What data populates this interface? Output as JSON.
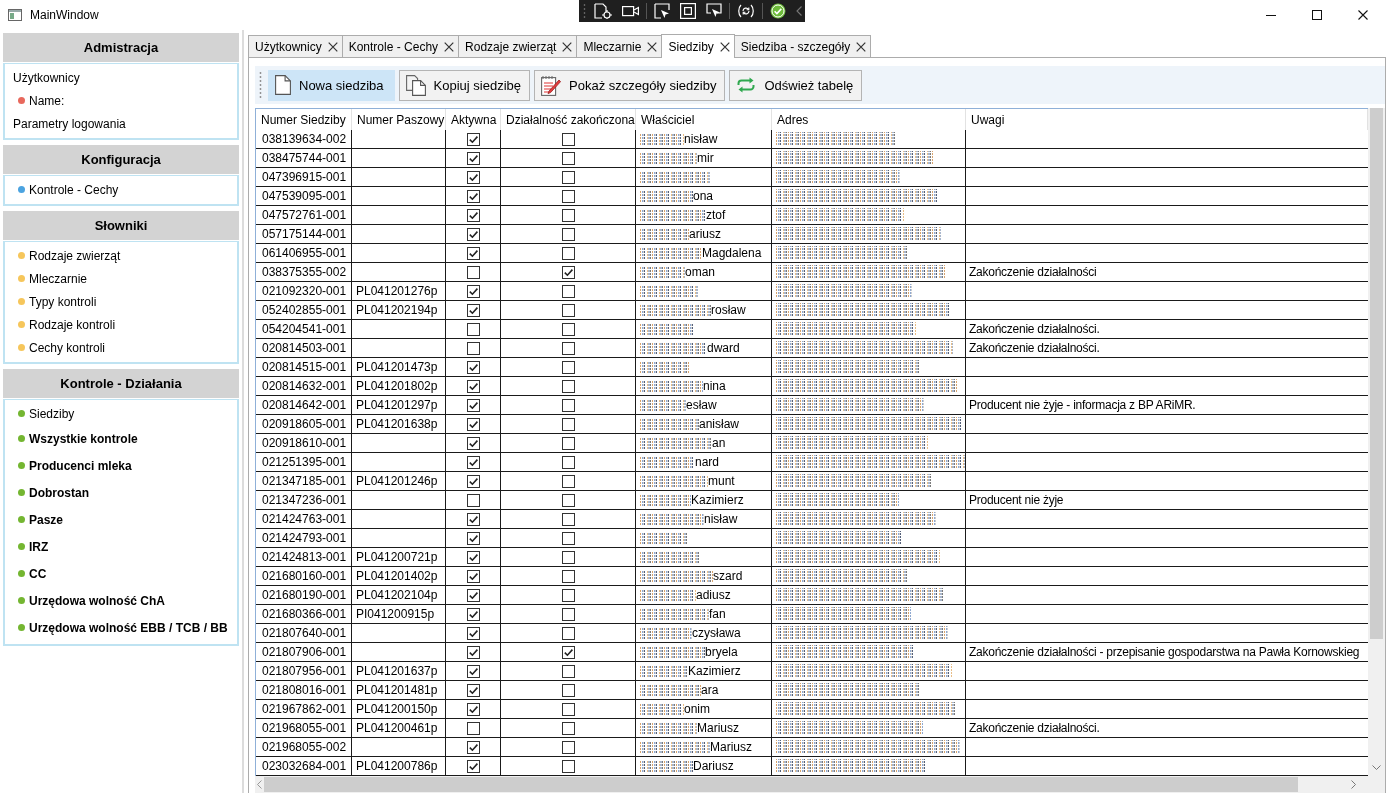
{
  "window": {
    "title": "MainWindow"
  },
  "sidebar": {
    "sections": [
      {
        "title": "Admistracja",
        "items": [
          {
            "label": "Użytkownicy",
            "bold": false
          },
          {
            "label": "Name:",
            "bold": false,
            "color": "#e8685c"
          },
          {
            "label": "Parametry logowania",
            "bold": false
          }
        ]
      },
      {
        "title": "Konfiguracja",
        "items": [
          {
            "label": "Kontrole - Cechy",
            "bold": false,
            "color": "#4ba3e0"
          }
        ]
      },
      {
        "title": "Słowniki",
        "items": [
          {
            "label": "Rodzaje zwierząt",
            "bold": false,
            "color": "#f6c65b"
          },
          {
            "label": "Mleczarnie",
            "bold": false,
            "color": "#f6c65b"
          },
          {
            "label": "Typy kontroli",
            "bold": false,
            "color": "#f6c65b"
          },
          {
            "label": "Rodzaje kontroli",
            "bold": false,
            "color": "#f6c65b"
          },
          {
            "label": "Cechy kontroli",
            "bold": false,
            "color": "#f6c65b"
          }
        ]
      },
      {
        "title": "Kontrole - Działania",
        "items": [
          {
            "label": "Siedziby",
            "bold": false,
            "color": "#74b631"
          },
          {
            "label": "Wszystkie kontrole",
            "bold": true,
            "color": "#74b631"
          },
          {
            "label": "Producenci mleka",
            "bold": true,
            "color": "#74b631"
          },
          {
            "label": "Dobrostan",
            "bold": true,
            "color": "#74b631"
          },
          {
            "label": "Pasze",
            "bold": true,
            "color": "#74b631"
          },
          {
            "label": "IRZ",
            "bold": true,
            "color": "#74b631"
          },
          {
            "label": "CC",
            "bold": true,
            "color": "#74b631"
          },
          {
            "label": "Urzędowa wolność ChA",
            "bold": true,
            "color": "#74b631"
          },
          {
            "label": "Urzędowa wolność EBB / TCB / BB",
            "bold": true,
            "color": "#74b631"
          }
        ]
      }
    ]
  },
  "tabs": [
    {
      "label": "Użytkownicy",
      "selected": false
    },
    {
      "label": "Kontrole - Cechy",
      "selected": false
    },
    {
      "label": "Rodzaje zwierząt",
      "selected": false
    },
    {
      "label": "Mleczarnie",
      "selected": false
    },
    {
      "label": "Siedziby",
      "selected": true
    },
    {
      "label": "Siedziba - szczegóły",
      "selected": false
    }
  ],
  "toolbar": {
    "buttons": [
      {
        "kind": "new",
        "label": "Nowa siedziba",
        "hovered": true
      },
      {
        "kind": "copy",
        "label": "Kopiuj siedzibę",
        "hovered": false
      },
      {
        "kind": "details",
        "label": "Pokaż szczegóły siedziby",
        "hovered": false
      },
      {
        "kind": "refresh",
        "label": "Odśwież tabelę",
        "hovered": false
      }
    ]
  },
  "table": {
    "columns": [
      "Numer Siedziby",
      "Numer Paszowy",
      "Aktywna",
      "Działalność zakończona",
      "Właściciel",
      "Adres",
      "Uwagi"
    ],
    "rows": [
      {
        "numer_siedziby": "038139634-002",
        "aktywna": true,
        "dzialalnosc_zakonczona": false,
        "wlasciciel": "nisław"
      },
      {
        "numer_siedziby": "038475744-001",
        "aktywna": true,
        "dzialalnosc_zakonczona": false,
        "wlasciciel": "mir"
      },
      {
        "numer_siedziby": "047396915-001",
        "aktywna": true,
        "dzialalnosc_zakonczona": false
      },
      {
        "numer_siedziby": "047539095-001",
        "aktywna": true,
        "dzialalnosc_zakonczona": false,
        "wlasciciel": "ona"
      },
      {
        "numer_siedziby": "047572761-001",
        "aktywna": true,
        "dzialalnosc_zakonczona": false,
        "wlasciciel": "ztof"
      },
      {
        "numer_siedziby": "057175144-001",
        "aktywna": true,
        "dzialalnosc_zakonczona": false,
        "wlasciciel": "ariusz"
      },
      {
        "numer_siedziby": "061406955-001",
        "aktywna": true,
        "dzialalnosc_zakonczona": false,
        "wlasciciel": "Magdalena"
      },
      {
        "numer_siedziby": "038375355-002",
        "aktywna": false,
        "dzialalnosc_zakonczona": true,
        "wlasciciel": "oman",
        "uwagi": "Zakończenie działalności"
      },
      {
        "numer_siedziby": "021092320-001",
        "numer_paszowy": "PL041201276p",
        "aktywna": true,
        "dzialalnosc_zakonczona": false
      },
      {
        "numer_siedziby": "052402855-001",
        "numer_paszowy": "PL041202194p",
        "aktywna": true,
        "dzialalnosc_zakonczona": false,
        "wlasciciel": "rosław"
      },
      {
        "numer_siedziby": "054204541-001",
        "aktywna": false,
        "dzialalnosc_zakonczona": false,
        "uwagi": "Zakończenie działalności."
      },
      {
        "numer_siedziby": "020814503-001",
        "aktywna": false,
        "dzialalnosc_zakonczona": false,
        "wlasciciel": "dward",
        "uwagi": "Zakończenie działalności."
      },
      {
        "numer_siedziby": "020814515-001",
        "numer_paszowy": "PL041201473p",
        "aktywna": true,
        "dzialalnosc_zakonczona": false
      },
      {
        "numer_siedziby": "020814632-001",
        "numer_paszowy": "PL041201802p",
        "aktywna": true,
        "dzialalnosc_zakonczona": false,
        "wlasciciel": "nina"
      },
      {
        "numer_siedziby": "020814642-001",
        "numer_paszowy": "PL041201297p",
        "aktywna": true,
        "dzialalnosc_zakonczona": false,
        "wlasciciel": "esław",
        "uwagi": "Producent nie żyje - informacja z BP ARiMR."
      },
      {
        "numer_siedziby": "020918605-001",
        "numer_paszowy": "PL041201638p",
        "aktywna": true,
        "dzialalnosc_zakonczona": false,
        "wlasciciel": "anisław"
      },
      {
        "numer_siedziby": "020918610-001",
        "aktywna": true,
        "dzialalnosc_zakonczona": false,
        "wlasciciel": "an"
      },
      {
        "numer_siedziby": "021251395-001",
        "aktywna": true,
        "dzialalnosc_zakonczona": false,
        "wlasciciel": "nard"
      },
      {
        "numer_siedziby": "021347185-001",
        "numer_paszowy": "PL041201246p",
        "aktywna": true,
        "dzialalnosc_zakonczona": false,
        "wlasciciel": "munt"
      },
      {
        "numer_siedziby": "021347236-001",
        "aktywna": false,
        "dzialalnosc_zakonczona": false,
        "wlasciciel": "Kazimierz",
        "uwagi": "Producent nie żyje"
      },
      {
        "numer_siedziby": "021424763-001",
        "aktywna": true,
        "dzialalnosc_zakonczona": false,
        "wlasciciel": "nisław"
      },
      {
        "numer_siedziby": "021424793-001",
        "aktywna": true,
        "dzialalnosc_zakonczona": false
      },
      {
        "numer_siedziby": "021424813-001",
        "numer_paszowy": "PL041200721p",
        "aktywna": true,
        "dzialalnosc_zakonczona": false
      },
      {
        "numer_siedziby": "021680160-001",
        "numer_paszowy": "PL041201402p",
        "aktywna": true,
        "dzialalnosc_zakonczona": false,
        "wlasciciel": "szard"
      },
      {
        "numer_siedziby": "021680190-001",
        "numer_paszowy": "PL041202104p",
        "aktywna": true,
        "dzialalnosc_zakonczona": false,
        "wlasciciel": "adiusz"
      },
      {
        "numer_siedziby": "021680366-001",
        "numer_paszowy": "PI041200915p",
        "aktywna": true,
        "dzialalnosc_zakonczona": false,
        "wlasciciel": "fan"
      },
      {
        "numer_siedziby": "021807640-001",
        "aktywna": true,
        "dzialalnosc_zakonczona": false,
        "wlasciciel": "czysława"
      },
      {
        "numer_siedziby": "021807906-001",
        "aktywna": true,
        "dzialalnosc_zakonczona": true,
        "wlasciciel": "bryela",
        "uwagi": "Zakończenie działalności - przepisanie gospodarstwa na Pawła Kornowskieg"
      },
      {
        "numer_siedziby": "021807956-001",
        "numer_paszowy": "PL041201637p",
        "aktywna": true,
        "dzialalnosc_zakonczona": false,
        "wlasciciel": "Kazimierz"
      },
      {
        "numer_siedziby": "021808016-001",
        "numer_paszowy": "PL041201481p",
        "aktywna": true,
        "dzialalnosc_zakonczona": false,
        "wlasciciel": "ara"
      },
      {
        "numer_siedziby": "021967862-001",
        "numer_paszowy": "PL041200150p",
        "aktywna": true,
        "dzialalnosc_zakonczona": false,
        "wlasciciel": "onim"
      },
      {
        "numer_siedziby": "021968055-001",
        "numer_paszowy": "PL041200461p",
        "aktywna": false,
        "dzialalnosc_zakonczona": false,
        "wlasciciel": "Mariusz",
        "uwagi": "Zakończenie działalności."
      },
      {
        "numer_siedziby": "021968055-002",
        "aktywna": true,
        "dzialalnosc_zakonczona": false,
        "wlasciciel": "Mariusz"
      },
      {
        "numer_siedziby": "023032684-001",
        "numer_paszowy": "PL041200786p",
        "aktywna": true,
        "dzialalnosc_zakonczona": false,
        "wlasciciel": "Dariusz"
      }
    ]
  }
}
